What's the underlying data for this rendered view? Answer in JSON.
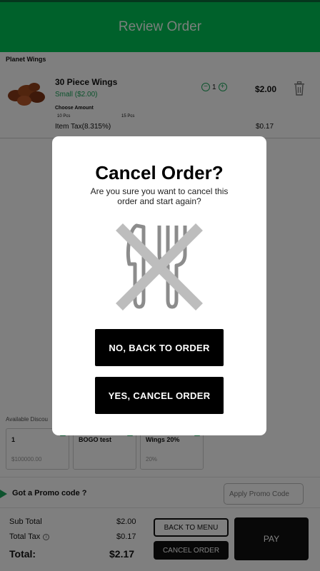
{
  "header": {
    "title": "Review Order"
  },
  "store": {
    "name": "Planet Wings"
  },
  "order_item": {
    "name": "30 Piece Wings",
    "size": "Small ($2.00)",
    "choose_label": "Choose Amount",
    "options": [
      "10 Pcs",
      "15 Pcs"
    ],
    "quantity": "1",
    "price": "$2.00",
    "tax_label": "Item Tax(8.315%)",
    "tax_value": "$0.17"
  },
  "discounts": {
    "title": "Available Discou",
    "items": [
      {
        "name": "1",
        "sub": "$100000.00"
      },
      {
        "name": "BOGO test",
        "sub": ""
      },
      {
        "name": "Wings 20%",
        "sub": "20%"
      }
    ]
  },
  "promo": {
    "label": "Got a Promo code ?",
    "placeholder": "Apply Promo Code"
  },
  "totals": {
    "sub_total_label": "Sub Total",
    "sub_total_value": "$2.00",
    "tax_label": "Total Tax",
    "tax_value": "$0.17",
    "total_label": "Total:",
    "total_value": "$2.17"
  },
  "actions": {
    "back_to_menu": "BACK TO MENU",
    "cancel_order": "CANCEL ORDER",
    "pay": "PAY"
  },
  "modal": {
    "title": "Cancel Order?",
    "message": "Are you sure you want to cancel this order and start again?",
    "no_button": "NO, BACK TO ORDER",
    "yes_button": "YES, CANCEL ORDER",
    "icon": "no-cutlery-icon"
  },
  "colors": {
    "accent": "#00c256",
    "dark": "#111111",
    "overlay": "rgba(0,0,0,0.5)"
  }
}
